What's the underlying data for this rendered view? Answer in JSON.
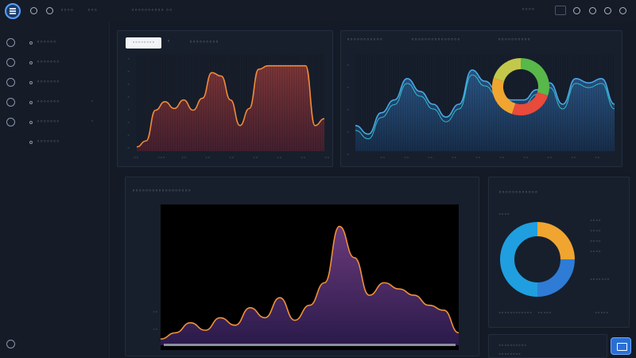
{
  "topbar": {
    "items": [
      "◦◦◦◦",
      "◦◦◦"
    ],
    "center_text": "◦◦◦◦◦◦◦◦◦◦  ◦◦",
    "right_items": [
      "◦◦◦◦"
    ]
  },
  "sidebar": {
    "items": [
      {
        "label": "◦◦◦◦◦◦"
      },
      {
        "label": "◦◦◦◦◦◦◦"
      },
      {
        "label": "◦◦◦◦◦◦◦"
      },
      {
        "label": "◦◦◦◦◦◦◦",
        "badge": "◦"
      },
      {
        "label": "◦◦◦◦◦◦◦",
        "badge": "◦"
      },
      {
        "label": "◦◦◦◦◦◦◦"
      }
    ]
  },
  "panel_left": {
    "tab_active": "◦◦◦◦◦◦◦◦",
    "title": "◦◦◦◦◦◦◦◦◦"
  },
  "panel_right": {
    "titles": [
      "◦◦◦◦◦◦◦◦◦◦◦",
      "◦◦◦◦◦◦◦◦◦◦◦◦◦◦◦",
      "◦◦◦◦◦◦◦◦◦◦"
    ]
  },
  "panel_bottom": {
    "title": "◦◦◦◦◦◦◦◦◦◦◦◦◦◦◦◦◦◦"
  },
  "panel_donut": {
    "title": "◦◦◦◦◦◦◦◦◦◦◦◦",
    "subtitle": "◦◦◦◦",
    "legend": [
      "◦◦◦◦",
      "◦◦◦◦",
      "◦◦◦◦",
      "◦◦◦◦",
      "◦◦◦◦◦◦◦"
    ],
    "footer": [
      "◦◦◦◦◦◦◦◦◦◦◦◦",
      "◦◦◦◦◦",
      "◦◦◦◦◦"
    ]
  },
  "panel_small": {
    "lines": [
      "◦◦◦◦◦◦◦◦◦◦",
      "◦◦◦◦◦◦◦◦"
    ]
  },
  "chart_data": [
    {
      "type": "area",
      "name": "left-area",
      "x": [
        0,
        1,
        2,
        3,
        4,
        5,
        6,
        7,
        8,
        9,
        10,
        11,
        12,
        13,
        14,
        15,
        16,
        17,
        18,
        19,
        20
      ],
      "values": [
        5,
        12,
        48,
        58,
        50,
        60,
        48,
        62,
        92,
        88,
        60,
        30,
        50,
        96,
        100,
        100,
        100,
        100,
        100,
        30,
        38
      ],
      "ylim": [
        0,
        110
      ],
      "ytick_labels": [
        "◦",
        "◦",
        "◦",
        "◦",
        "◦",
        "◦",
        "◦",
        "◦"
      ],
      "xtick_labels": [
        "◦◦",
        "◦◦◦",
        "◦◦",
        "◦◦",
        "◦◦",
        "◦◦",
        "◦◦",
        "◦◦",
        "◦◦"
      ]
    },
    {
      "type": "area",
      "name": "right-area",
      "x": [
        0,
        1,
        2,
        3,
        4,
        5,
        6,
        7,
        8,
        9,
        10,
        11,
        12,
        13,
        14,
        15,
        16,
        17,
        18,
        19,
        20
      ],
      "values": [
        30,
        20,
        45,
        60,
        85,
        70,
        55,
        40,
        55,
        95,
        82,
        70,
        60,
        60,
        72,
        80,
        55,
        85,
        80,
        85,
        55
      ],
      "ylim": [
        0,
        110
      ],
      "ytick_labels": [
        "◦",
        "◦",
        "◦",
        "◦",
        "◦"
      ],
      "xtick_labels": [
        "◦◦",
        "◦◦",
        "◦◦",
        "◦◦",
        "◦◦",
        "◦◦",
        "◦◦",
        "◦◦",
        "◦◦",
        "◦◦"
      ]
    },
    {
      "type": "pie",
      "name": "small-donut",
      "values": [
        30,
        25,
        25,
        20
      ],
      "colors": [
        "#58b84a",
        "#e84a3b",
        "#f0a530",
        "#c3c84a"
      ]
    },
    {
      "type": "area",
      "name": "bottom-area",
      "x": [
        0,
        1,
        2,
        3,
        4,
        5,
        6,
        7,
        8,
        9,
        10,
        11,
        12,
        13,
        14,
        15,
        16,
        17,
        18,
        19,
        20
      ],
      "values": [
        5,
        10,
        18,
        12,
        22,
        16,
        30,
        22,
        38,
        20,
        32,
        50,
        95,
        70,
        40,
        50,
        45,
        40,
        32,
        28,
        10
      ],
      "ylim": [
        0,
        110
      ],
      "ytick_labels": [
        "◦◦",
        "◦◦"
      ]
    },
    {
      "type": "pie",
      "name": "large-donut",
      "values": [
        25,
        25,
        50
      ],
      "colors": [
        "#f0a530",
        "#2e7cd6",
        "#1f9fe0"
      ]
    }
  ]
}
